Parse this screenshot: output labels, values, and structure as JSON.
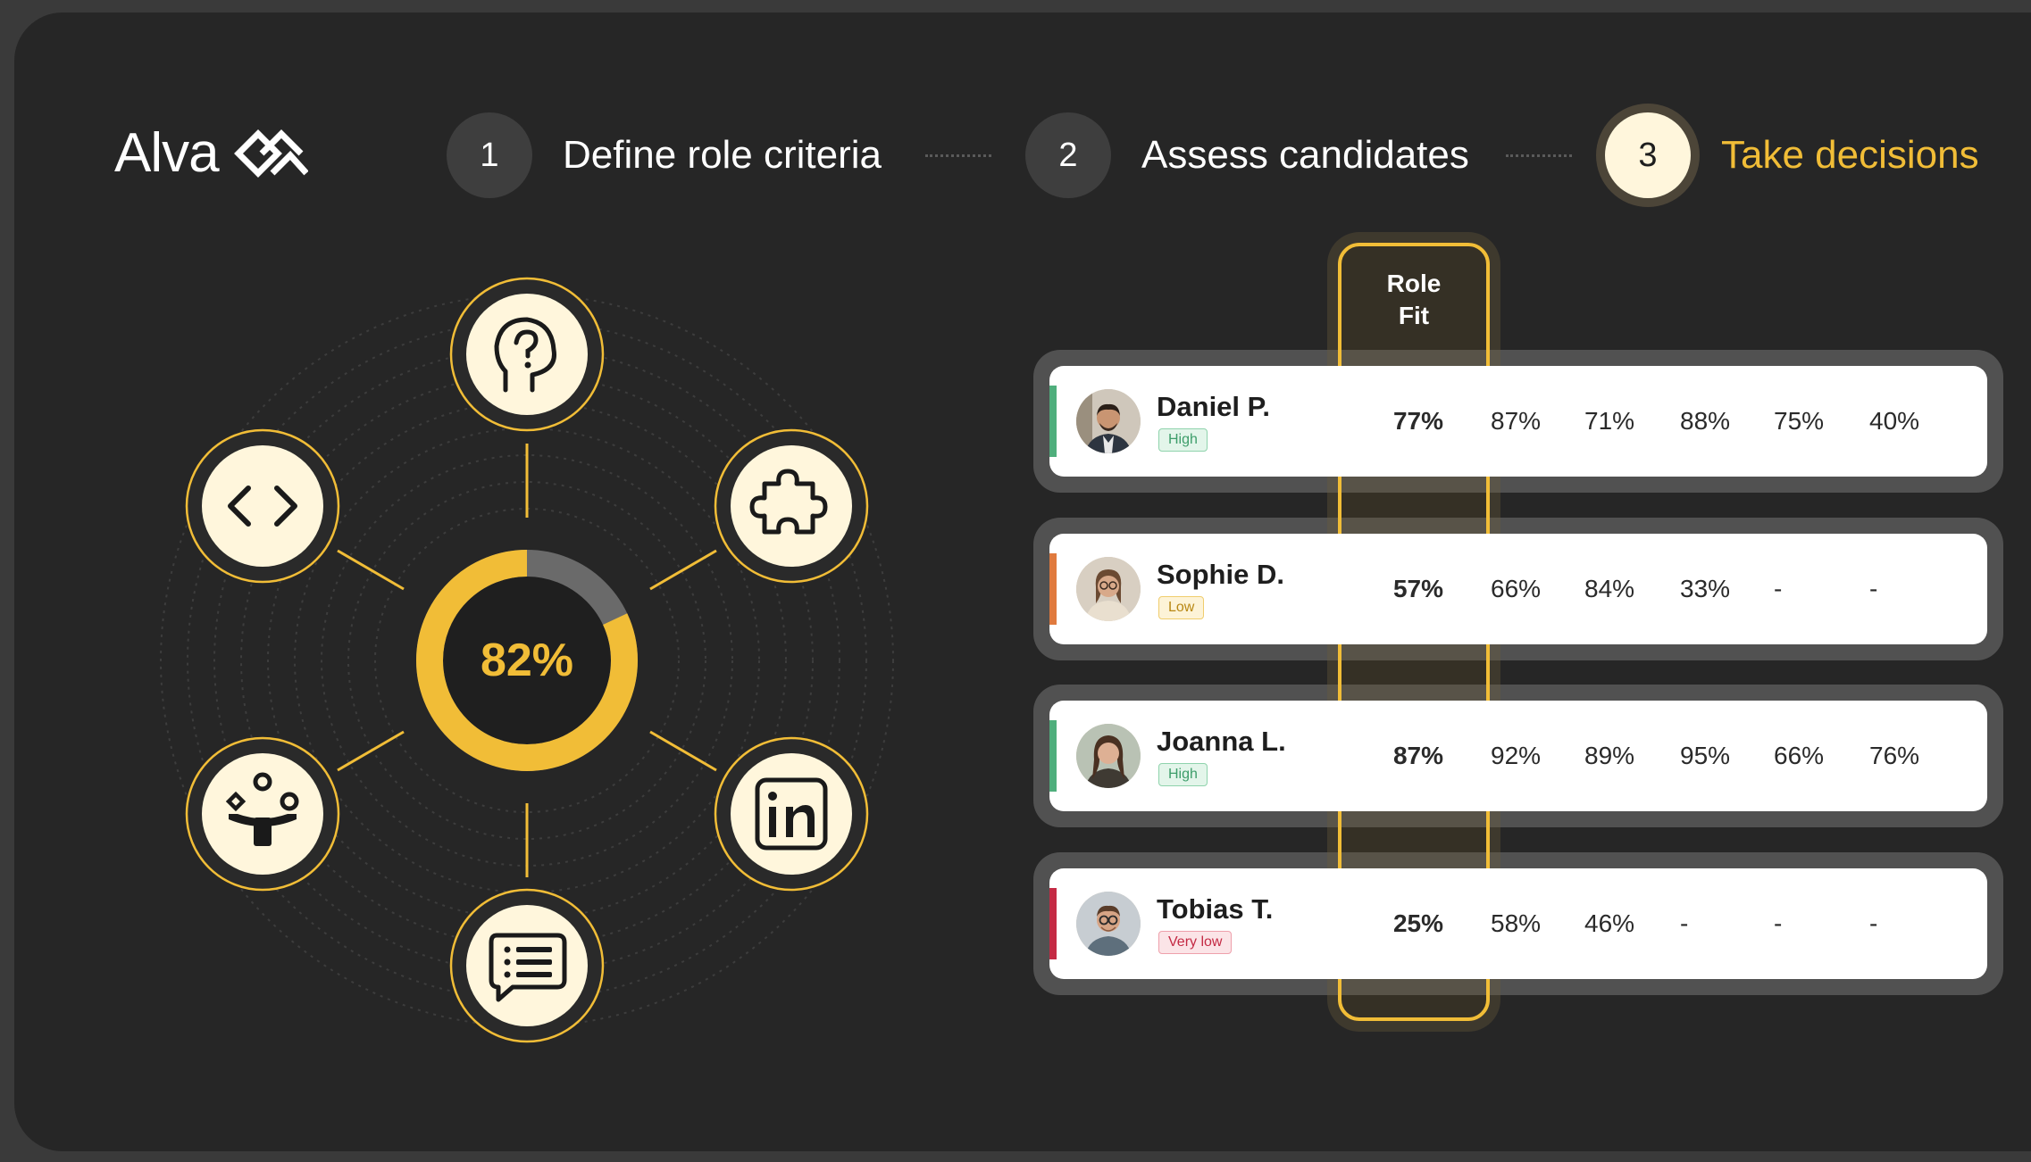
{
  "brand": {
    "name": "Alva"
  },
  "steps": [
    {
      "number": "1",
      "label": "Define role criteria",
      "active": false
    },
    {
      "number": "2",
      "label": "Assess candidates",
      "active": false
    },
    {
      "number": "3",
      "label": "Take decisions",
      "active": true
    }
  ],
  "score": {
    "label": "82%",
    "value": 0.82,
    "fill_color": "#f1bd37",
    "track_color": "#6a6a6a"
  },
  "assessment_icons": [
    "head-question-icon",
    "puzzle-icon",
    "linkedin-icon",
    "chat-list-icon",
    "team-icon",
    "code-icon"
  ],
  "table": {
    "header": {
      "line1": "Role",
      "line2": "Fit"
    },
    "rows": [
      {
        "name": "Daniel P.",
        "level": "High",
        "level_color": "#4fae7c",
        "fit": "77%",
        "scores": [
          "87%",
          "71%",
          "88%",
          "75%",
          "40%"
        ]
      },
      {
        "name": "Sophie D.",
        "level": "Low",
        "level_color": "#e2a72a",
        "fit": "57%",
        "scores": [
          "66%",
          "84%",
          "33%",
          "-",
          "-"
        ]
      },
      {
        "name": "Joanna L.",
        "level": "High",
        "level_color": "#4fae7c",
        "fit": "87%",
        "scores": [
          "92%",
          "89%",
          "95%",
          "66%",
          "76%"
        ]
      },
      {
        "name": "Tobias T.",
        "level": "Very low",
        "level_color": "#d2394b",
        "fit": "25%",
        "scores": [
          "58%",
          "46%",
          "-",
          "-",
          "-"
        ]
      }
    ]
  },
  "colors": {
    "accent": "#f1bd37",
    "background": "#262626"
  }
}
